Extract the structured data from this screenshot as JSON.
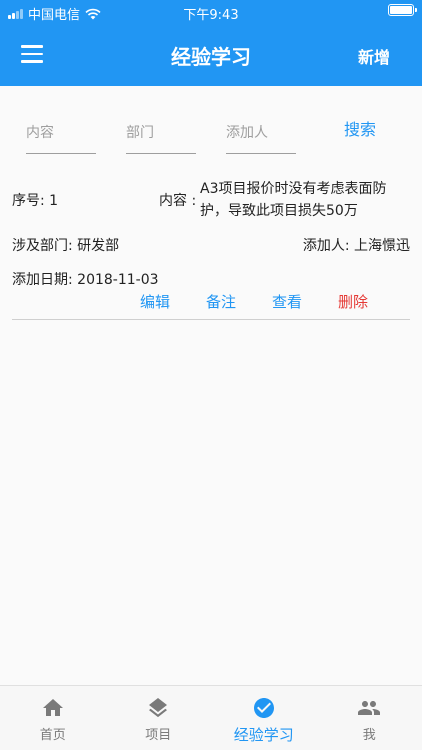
{
  "status_bar": {
    "carrier": "中国电信",
    "time": "下午9:43"
  },
  "app_bar": {
    "title": "经验学习",
    "add_label": "新增"
  },
  "search": {
    "content_placeholder": "内容",
    "department_placeholder": "部门",
    "adder_placeholder": "添加人",
    "button_label": "搜索"
  },
  "records": [
    {
      "seq_label": "序号: 1",
      "content_label": "内容 :",
      "content": "A3项目报价时没有考虑表面防护，导致此项目损失50万",
      "department_label": "涉及部门: 研发部",
      "adder_label": "添加人: 上海憬迅",
      "date_label": "添加日期: 2018-11-03",
      "actions": {
        "edit": "编辑",
        "note": "备注",
        "view": "查看",
        "delete": "删除"
      }
    }
  ],
  "bottom_nav": [
    {
      "label": "首页",
      "icon": "home-icon"
    },
    {
      "label": "项目",
      "icon": "layers-icon"
    },
    {
      "label": "经验学习",
      "icon": "check-circle-icon",
      "active": true
    },
    {
      "label": "我",
      "icon": "people-icon"
    }
  ],
  "colors": {
    "primary": "#2196f3",
    "danger": "#e53935"
  }
}
